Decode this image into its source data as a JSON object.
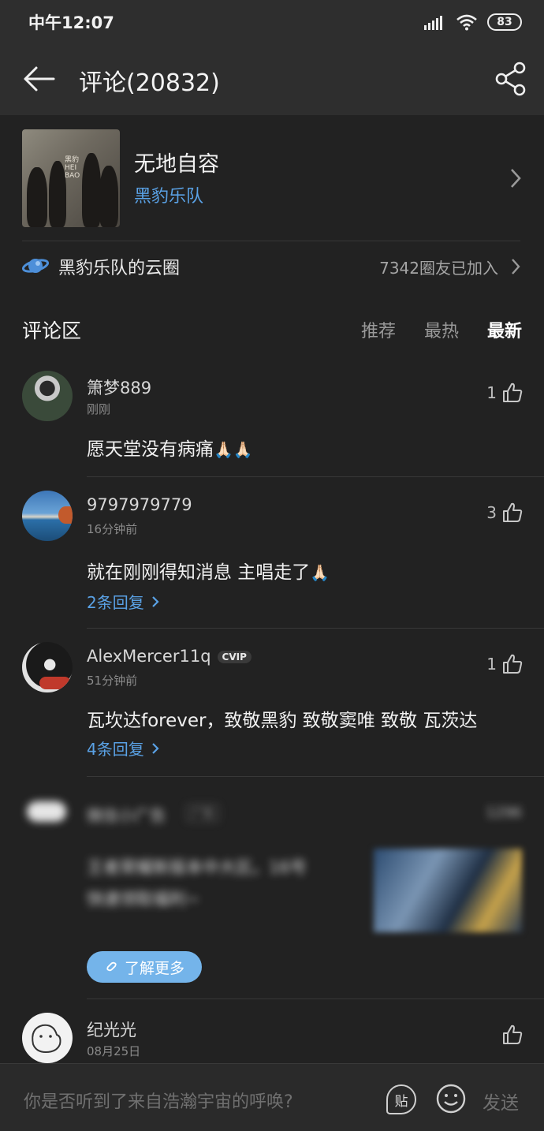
{
  "status_bar": {
    "time": "中午12:07",
    "battery": "83"
  },
  "header": {
    "title": "评论(20832)"
  },
  "song": {
    "title": "无地自容",
    "artist": "黑豹乐队",
    "cover_text": "黑豹 HEI BAO"
  },
  "circle": {
    "label": "黑豹乐队的云圈",
    "count": "7342圈友已加入"
  },
  "comments_section": {
    "title": "评论区",
    "tabs": [
      {
        "label": "推荐"
      },
      {
        "label": "最热"
      },
      {
        "label": "最新"
      }
    ],
    "active_tab": "最新"
  },
  "comments": [
    {
      "name": "箫梦889",
      "time": "刚刚",
      "likes": "1",
      "text": "愿天堂没有病痛",
      "emoji": "🙏🏻🙏🏻",
      "replies": ""
    },
    {
      "name": "9797979779",
      "time": "16分钟前",
      "likes": "3",
      "text": "就在刚刚得知消息 主唱走了",
      "emoji": "🙏🏻",
      "replies": "2条回复"
    },
    {
      "name": "AlexMercer11q",
      "badge": "CVIP",
      "time": "51分钟前",
      "likes": "1",
      "text": "瓦坎达forever，致敬黑豹 致敬窦唯 致敬 瓦茨达",
      "emoji": "",
      "replies": "4条回复"
    },
    {
      "name": "纪光光",
      "time": "08月25日",
      "likes": "",
      "text": "",
      "emoji": "",
      "replies": ""
    }
  ],
  "ad": {
    "name": "微信小广告",
    "tag": "广告",
    "right": "1296",
    "text_line1": "王者荣耀新版本中大区。16号",
    "text_line2": "快速领取福利~",
    "cta": "了解更多"
  },
  "bottom_bar": {
    "placeholder": "你是否听到了来自浩瀚宇宙的呼唤?",
    "sticker_label": "贴",
    "send_label": "发送"
  },
  "colors": {
    "accent_blue": "#5aa2e6",
    "button_blue": "#74b4ea",
    "background": "#222222"
  }
}
